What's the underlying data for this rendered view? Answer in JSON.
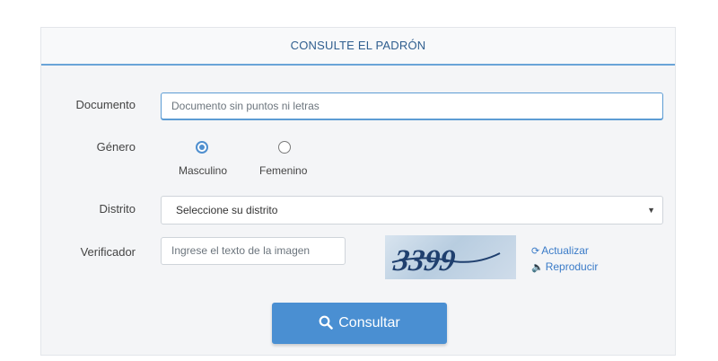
{
  "header": {
    "title": "CONSULTE EL PADRÓN"
  },
  "form": {
    "documento": {
      "label": "Documento",
      "placeholder": "Documento sin puntos ni letras"
    },
    "genero": {
      "label": "Género",
      "options": [
        {
          "label": "Masculino",
          "selected": true
        },
        {
          "label": "Femenino",
          "selected": false
        }
      ]
    },
    "distrito": {
      "label": "Distrito",
      "value": "Seleccione su distrito"
    },
    "verificador": {
      "label": "Verificador",
      "placeholder": "Ingrese el texto de la imagen",
      "captcha_text": "3399",
      "refresh_label": "Actualizar",
      "play_label": "Reproducir"
    },
    "submit_label": "Consultar"
  },
  "colors": {
    "accent": "#4a8fd2",
    "link": "#3a7bc8",
    "header_text": "#2f5e8f"
  },
  "icons": {
    "refresh": "refresh-icon",
    "audio": "speaker-icon",
    "search": "search-icon",
    "dropdown": "caret-down-icon"
  }
}
